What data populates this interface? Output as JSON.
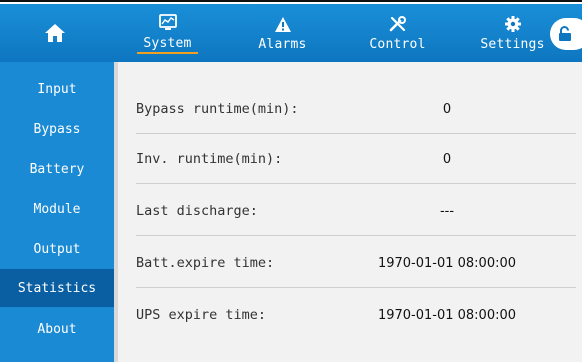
{
  "header": {
    "tabs": [
      {
        "label": "System",
        "icon": "chart-monitor-icon",
        "active": true
      },
      {
        "label": "Alarms",
        "icon": "warning-icon",
        "active": false
      },
      {
        "label": "Control",
        "icon": "tools-icon",
        "active": false
      },
      {
        "label": "Settings",
        "icon": "gear-icon",
        "active": false
      }
    ]
  },
  "sidebar": {
    "items": [
      {
        "label": "Input"
      },
      {
        "label": "Bypass"
      },
      {
        "label": "Battery"
      },
      {
        "label": "Module"
      },
      {
        "label": "Output"
      },
      {
        "label": "Statistics"
      },
      {
        "label": "About"
      }
    ],
    "active_index": 5
  },
  "statistics": {
    "rows": [
      {
        "label": "Bypass runtime(min):",
        "value": "0"
      },
      {
        "label": "Inv. runtime(min):",
        "value": "0"
      },
      {
        "label": "Last discharge:",
        "value": "---"
      },
      {
        "label": "Batt.expire time:",
        "value": "1970-01-01 08:00:00"
      },
      {
        "label": "UPS expire time:",
        "value": "1970-01-01 08:00:00"
      }
    ]
  },
  "colors": {
    "header_blue": "#1a8fd8",
    "sidebar_blue": "#1a8ad4",
    "sidebar_active": "#0a5fa3",
    "tab_underline": "#f0a020",
    "content_bg": "#f2f2f2"
  }
}
